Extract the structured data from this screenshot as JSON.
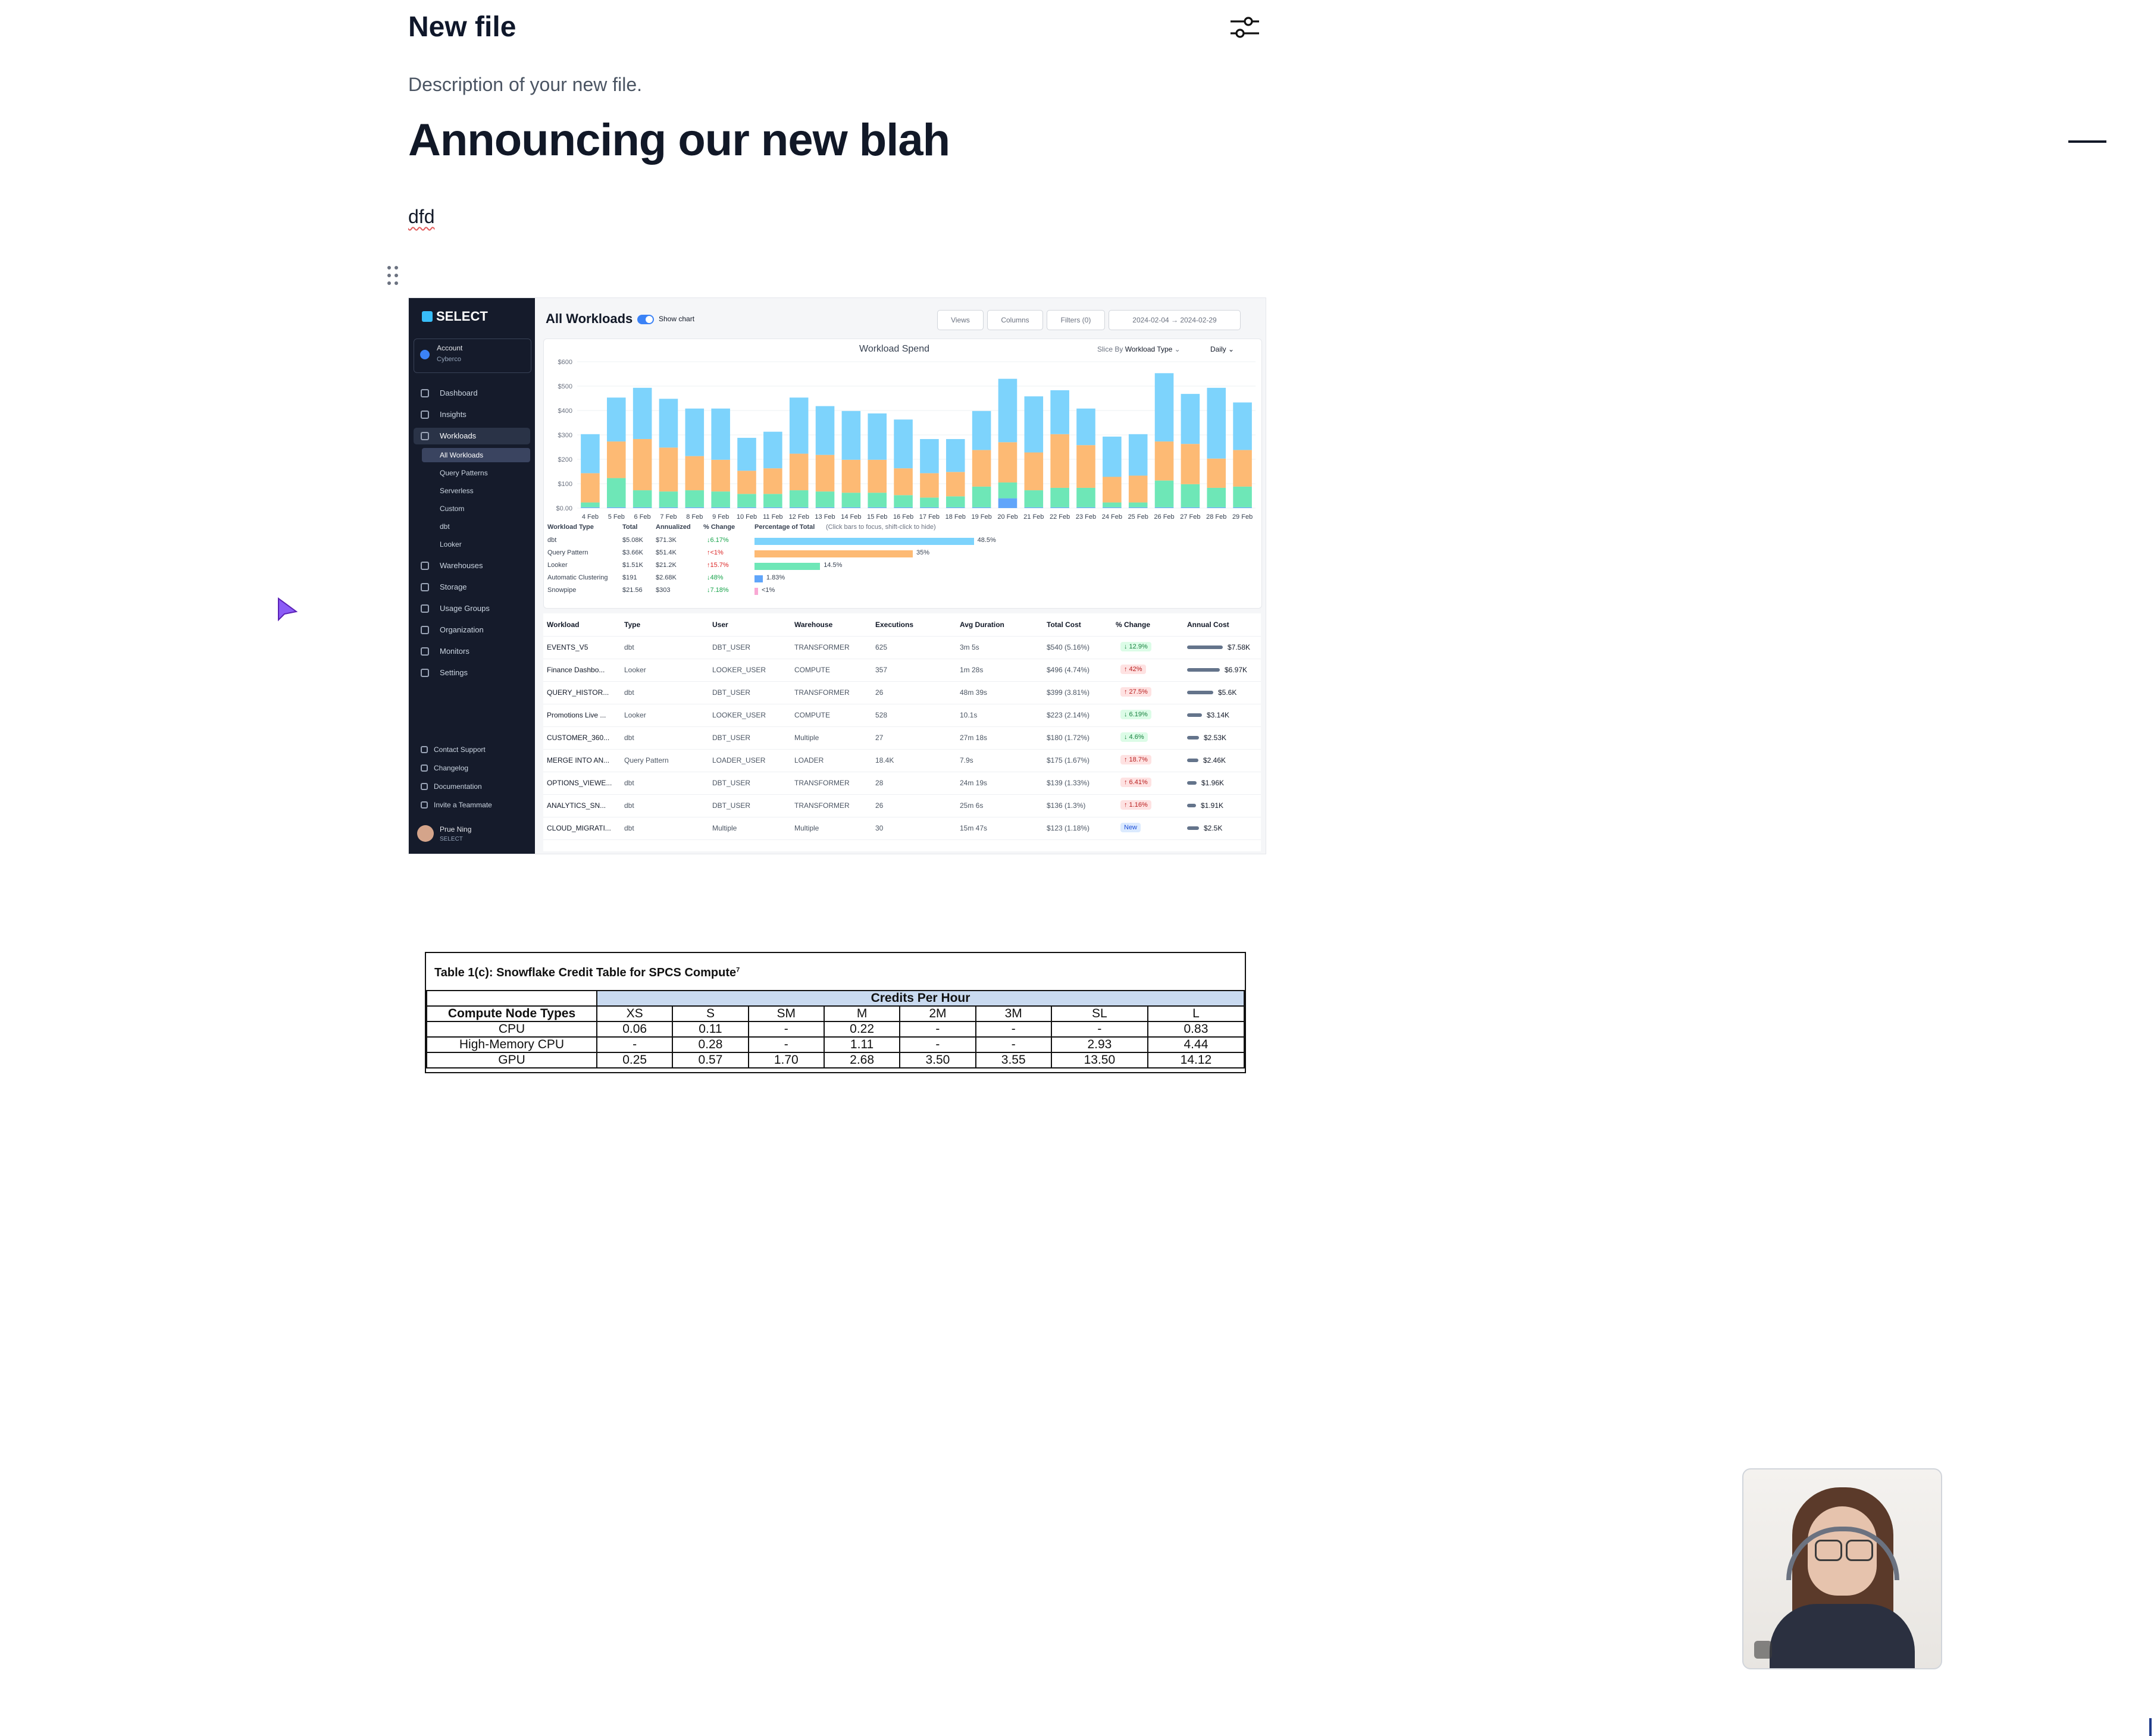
{
  "editor": {
    "title": "New file",
    "description": "Description of your new file.",
    "heading": "Announcing our new blah",
    "paragraph": "dfd"
  },
  "app": {
    "logo": "SELECT",
    "account_label": "Account",
    "account_name": "Cyberco",
    "nav": [
      {
        "label": "Dashboard",
        "icon": "home-icon"
      },
      {
        "label": "Insights",
        "icon": "lightbulb-icon"
      },
      {
        "label": "Workloads",
        "icon": "workloads-icon"
      },
      {
        "label": "Warehouses",
        "icon": "warehouse-icon"
      },
      {
        "label": "Storage",
        "icon": "database-icon"
      },
      {
        "label": "Usage Groups",
        "icon": "usage-groups-icon"
      },
      {
        "label": "Organization",
        "icon": "building-icon"
      },
      {
        "label": "Monitors",
        "icon": "pulse-icon"
      },
      {
        "label": "Settings",
        "icon": "gear-icon"
      }
    ],
    "workload_sub": [
      "All Workloads",
      "Query Patterns",
      "Serverless",
      "Custom",
      "dbt",
      "Looker"
    ],
    "footer_nav": [
      "Contact Support",
      "Changelog",
      "Documentation",
      "Invite a Teammate"
    ],
    "user_name": "Prue Ning",
    "user_org": "SELECT",
    "page_title": "All Workloads",
    "show_chart": "Show chart",
    "toolbar": {
      "views": "Views",
      "columns": "Columns",
      "filters": "Filters (0)",
      "date_range": "2024-02-04 → 2024-02-29"
    },
    "chart_title": "Workload Spend",
    "slice_by_label": "Slice By",
    "slice_by_value": "Workload Type",
    "granularity": "Daily",
    "legend_headers": [
      "Workload Type",
      "Total",
      "Annualized",
      "% Change",
      "Percentage of Total",
      "(Click bars to focus, shift-click to hide)"
    ],
    "legend_rows": [
      {
        "type": "dbt",
        "total": "$5.08K",
        "annual": "$71.3K",
        "change": "↓6.17%",
        "pct": "48.5%",
        "frac": 0.485,
        "color": "#7dd3fc"
      },
      {
        "type": "Query Pattern",
        "total": "$3.66K",
        "annual": "$51.4K",
        "change": "↑<1%",
        "pct": "35%",
        "frac": 0.35,
        "color": "#fdba74"
      },
      {
        "type": "Looker",
        "total": "$1.51K",
        "annual": "$21.2K",
        "change": "↑15.7%",
        "pct": "14.5%",
        "frac": 0.145,
        "color": "#6ee7b7"
      },
      {
        "type": "Automatic Clustering",
        "total": "$191",
        "annual": "$2.68K",
        "change": "↓48%",
        "pct": "1.83%",
        "frac": 0.0183,
        "color": "#60a5fa"
      },
      {
        "type": "Snowpipe",
        "total": "$21.56",
        "annual": "$303",
        "change": "↓7.18%",
        "pct": "<1%",
        "frac": 0.005,
        "color": "#f9a8d4"
      }
    ],
    "table_headers": [
      "Workload",
      "Type",
      "User",
      "Warehouse",
      "Executions",
      "Avg Duration",
      "Total Cost",
      "% Change",
      "Annual Cost"
    ],
    "table_rows": [
      {
        "workload": "EVENTS_V5",
        "type": "dbt",
        "user": "DBT_USER",
        "warehouse": "TRANSFORMER",
        "exec": "625",
        "dur": "3m 5s",
        "cost": "$540 (5.16%)",
        "change": "↓ 12.9%",
        "dir": "down",
        "annual": "$7.58K",
        "share": 1.0
      },
      {
        "workload": "Finance Dashbo...",
        "type": "Looker",
        "user": "LOOKER_USER",
        "warehouse": "COMPUTE",
        "exec": "357",
        "dur": "1m 28s",
        "cost": "$496 (4.74%)",
        "change": "↑ 42%",
        "dir": "up",
        "annual": "$6.97K",
        "share": 0.92
      },
      {
        "workload": "QUERY_HISTOR...",
        "type": "dbt",
        "user": "DBT_USER",
        "warehouse": "TRANSFORMER",
        "exec": "26",
        "dur": "48m 39s",
        "cost": "$399 (3.81%)",
        "change": "↑ 27.5%",
        "dir": "up",
        "annual": "$5.6K",
        "share": 0.74
      },
      {
        "workload": "Promotions Live ...",
        "type": "Looker",
        "user": "LOOKER_USER",
        "warehouse": "COMPUTE",
        "exec": "528",
        "dur": "10.1s",
        "cost": "$223 (2.14%)",
        "change": "↓ 6.19%",
        "dir": "down",
        "annual": "$3.14K",
        "share": 0.41
      },
      {
        "workload": "CUSTOMER_360...",
        "type": "dbt",
        "user": "DBT_USER",
        "warehouse": "Multiple",
        "exec": "27",
        "dur": "27m 18s",
        "cost": "$180 (1.72%)",
        "change": "↓ 4.6%",
        "dir": "down",
        "annual": "$2.53K",
        "share": 0.33
      },
      {
        "workload": "MERGE INTO AN...",
        "type": "Query Pattern",
        "user": "LOADER_USER",
        "warehouse": "LOADER",
        "exec": "18.4K",
        "dur": "7.9s",
        "cost": "$175 (1.67%)",
        "change": "↑ 18.7%",
        "dir": "up",
        "annual": "$2.46K",
        "share": 0.32
      },
      {
        "workload": "OPTIONS_VIEWE...",
        "type": "dbt",
        "user": "DBT_USER",
        "warehouse": "TRANSFORMER",
        "exec": "28",
        "dur": "24m 19s",
        "cost": "$139 (1.33%)",
        "change": "↑ 6.41%",
        "dir": "up",
        "annual": "$1.96K",
        "share": 0.26
      },
      {
        "workload": "ANALYTICS_SN...",
        "type": "dbt",
        "user": "DBT_USER",
        "warehouse": "TRANSFORMER",
        "exec": "26",
        "dur": "25m 6s",
        "cost": "$136 (1.3%)",
        "change": "↑ 1.16%",
        "dir": "up",
        "annual": "$1.91K",
        "share": 0.25
      },
      {
        "workload": "CLOUD_MIGRATI...",
        "type": "dbt",
        "user": "Multiple",
        "warehouse": "Multiple",
        "exec": "30",
        "dur": "15m 47s",
        "cost": "$123 (1.18%)",
        "change": "New",
        "dir": "new",
        "annual": "$2.5K",
        "share": 0.33
      }
    ]
  },
  "chart_data": {
    "type": "bar",
    "title": "Workload Spend",
    "xlabel": "",
    "ylabel": "",
    "ylim": [
      0,
      600
    ],
    "yticks": [
      "$0.00",
      "$100",
      "$200",
      "$300",
      "$400",
      "$500",
      "$600"
    ],
    "stacked": true,
    "categories": [
      "4 Feb",
      "5 Feb",
      "6 Feb",
      "7 Feb",
      "8 Feb",
      "9 Feb",
      "10 Feb",
      "11 Feb",
      "12 Feb",
      "13 Feb",
      "14 Feb",
      "15 Feb",
      "16 Feb",
      "17 Feb",
      "18 Feb",
      "19 Feb",
      "20 Feb",
      "21 Feb",
      "22 Feb",
      "23 Feb",
      "24 Feb",
      "25 Feb",
      "26 Feb",
      "27 Feb",
      "28 Feb",
      "29 Feb"
    ],
    "series": [
      {
        "name": "Automatic Clustering",
        "color": "#60a5fa",
        "values": [
          3,
          3,
          3,
          3,
          3,
          3,
          3,
          3,
          3,
          3,
          3,
          3,
          3,
          3,
          3,
          3,
          40,
          3,
          3,
          3,
          3,
          3,
          3,
          3,
          3,
          3
        ]
      },
      {
        "name": "Looker",
        "color": "#6ee7b7",
        "values": [
          20,
          120,
          70,
          65,
          70,
          65,
          55,
          55,
          70,
          65,
          60,
          60,
          50,
          40,
          45,
          85,
          65,
          70,
          80,
          80,
          20,
          20,
          110,
          95,
          80,
          85
        ]
      },
      {
        "name": "Query Pattern",
        "color": "#fdba74",
        "values": [
          120,
          150,
          210,
          180,
          140,
          130,
          95,
          105,
          150,
          150,
          135,
          135,
          110,
          100,
          100,
          150,
          165,
          155,
          220,
          175,
          105,
          110,
          160,
          165,
          120,
          150
        ]
      },
      {
        "name": "dbt",
        "color": "#7dd3fc",
        "values": [
          160,
          180,
          210,
          200,
          195,
          210,
          135,
          150,
          230,
          200,
          200,
          190,
          200,
          140,
          135,
          160,
          260,
          230,
          180,
          150,
          165,
          170,
          280,
          205,
          290,
          195
        ]
      }
    ]
  },
  "credit_table": {
    "title": "Table 1(c): Snowflake Credit Table for SPCS Compute",
    "title_sup": "7",
    "band": "Credits Per Hour",
    "header_first": "Compute Node Types",
    "sizes": [
      "XS",
      "S",
      "SM",
      "M",
      "2M",
      "3M",
      "SL",
      "L"
    ],
    "rows": [
      {
        "name": "CPU",
        "values": [
          "0.06",
          "0.11",
          "-",
          "0.22",
          "-",
          "-",
          "-",
          "0.83"
        ]
      },
      {
        "name": "High-Memory CPU",
        "values": [
          "-",
          "0.28",
          "-",
          "1.11",
          "-",
          "-",
          "2.93",
          "4.44"
        ]
      },
      {
        "name": "GPU",
        "values": [
          "0.25",
          "0.57",
          "1.70",
          "2.68",
          "3.50",
          "3.55",
          "13.50",
          "14.12"
        ]
      }
    ]
  }
}
